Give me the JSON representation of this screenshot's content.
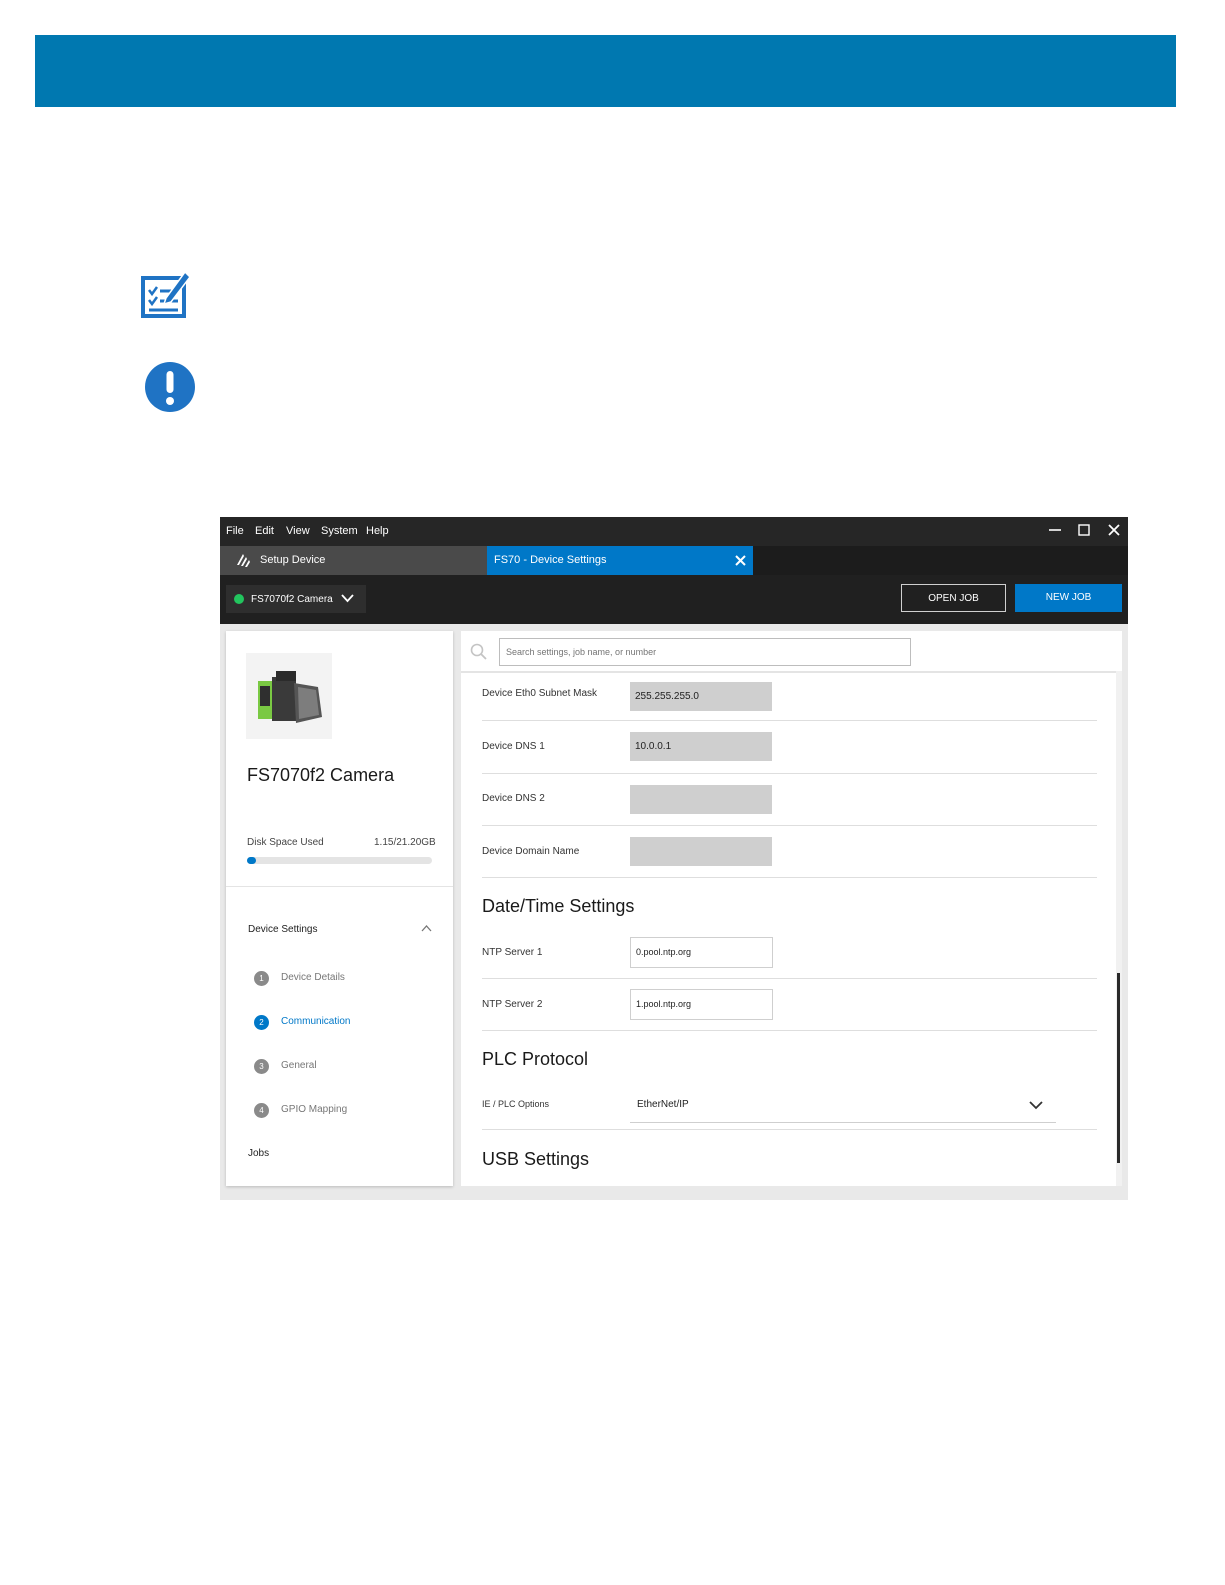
{
  "menubar": {
    "items": [
      "File",
      "Edit",
      "View",
      "System",
      "Help"
    ]
  },
  "tabs": {
    "setup_label": "Setup Device",
    "settings_label": "FS70 - Device Settings"
  },
  "toolbar": {
    "device_name": "FS7070f2 Camera",
    "open_job": "OPEN JOB",
    "new_job": "NEW JOB"
  },
  "device": {
    "title": "FS7070f2 Camera",
    "disk_label": "Disk Space Used",
    "disk_value": "1.15/21.20GB",
    "disk_fraction": 0.05
  },
  "nav": {
    "section_title": "Device Settings",
    "steps": [
      {
        "num": "1",
        "label": "Device Details"
      },
      {
        "num": "2",
        "label": "Communication"
      },
      {
        "num": "3",
        "label": "General"
      },
      {
        "num": "4",
        "label": "GPIO Mapping"
      }
    ],
    "jobs_label": "Jobs"
  },
  "search": {
    "placeholder": "Search settings, job name, or number"
  },
  "network": {
    "subnet_label": "Device Eth0 Subnet Mask",
    "subnet_value": "255.255.255.0",
    "dns1_label": "Device DNS 1",
    "dns1_value": "10.0.0.1",
    "dns2_label": "Device DNS 2",
    "dns2_value": "",
    "domain_label": "Device Domain Name",
    "domain_value": ""
  },
  "datetime": {
    "title": "Date/Time Settings",
    "ntp1_label": "NTP Server 1",
    "ntp1_value": "0.pool.ntp.org",
    "ntp2_label": "NTP Server 2",
    "ntp2_value": "1.pool.ntp.org"
  },
  "plc": {
    "title": "PLC Protocol",
    "options_label": "IE / PLC Options",
    "options_value": "EtherNet/IP"
  },
  "usb": {
    "title": "USB Settings"
  },
  "colors": {
    "brand_blue": "#0078b0",
    "accent_blue": "#0078c8",
    "status_green": "#22c55e"
  },
  "icons": {
    "note": "note-edit-icon",
    "important": "exclamation-circle-icon"
  }
}
